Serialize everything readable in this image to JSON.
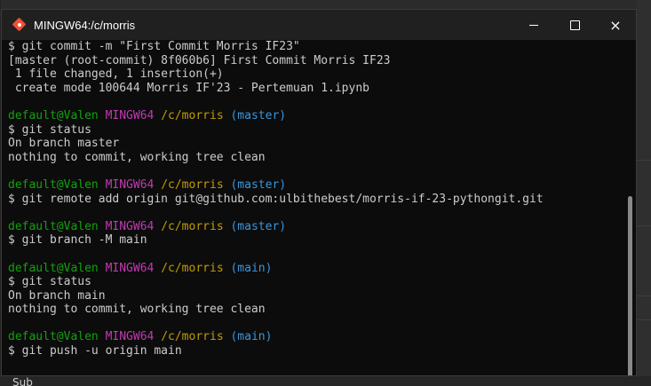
{
  "window": {
    "title": "MINGW64:/c/morris",
    "controls": {
      "minimize": "minimize-icon",
      "maximize": "maximize-icon",
      "close": "×"
    }
  },
  "prompt": {
    "user_host": "default@Valen",
    "shell": "MINGW64",
    "path": "/c/morris"
  },
  "terminal": {
    "lines": [
      "$ git commit -m \"First Commit Morris IF23\"",
      "[master (root-commit) 8f060b6] First Commit Morris IF23",
      " 1 file changed, 1 insertion(+)",
      " create mode 100644 Morris IF'23 - Pertemuan 1.ipynb",
      "",
      "(master)",
      "$ git status",
      "On branch master",
      "nothing to commit, working tree clean",
      "",
      "(master)",
      "$ git remote add origin git@github.com:ulbithebest/morris-if-23-pythongit.git",
      "",
      "(master)",
      "$ git branch -M main",
      "",
      "(main)",
      "$ git status",
      "On branch main",
      "nothing to commit, working tree clean",
      "",
      "(main)",
      "$ git push -u origin main"
    ]
  },
  "background": {
    "bottom_text": "Sub"
  }
}
